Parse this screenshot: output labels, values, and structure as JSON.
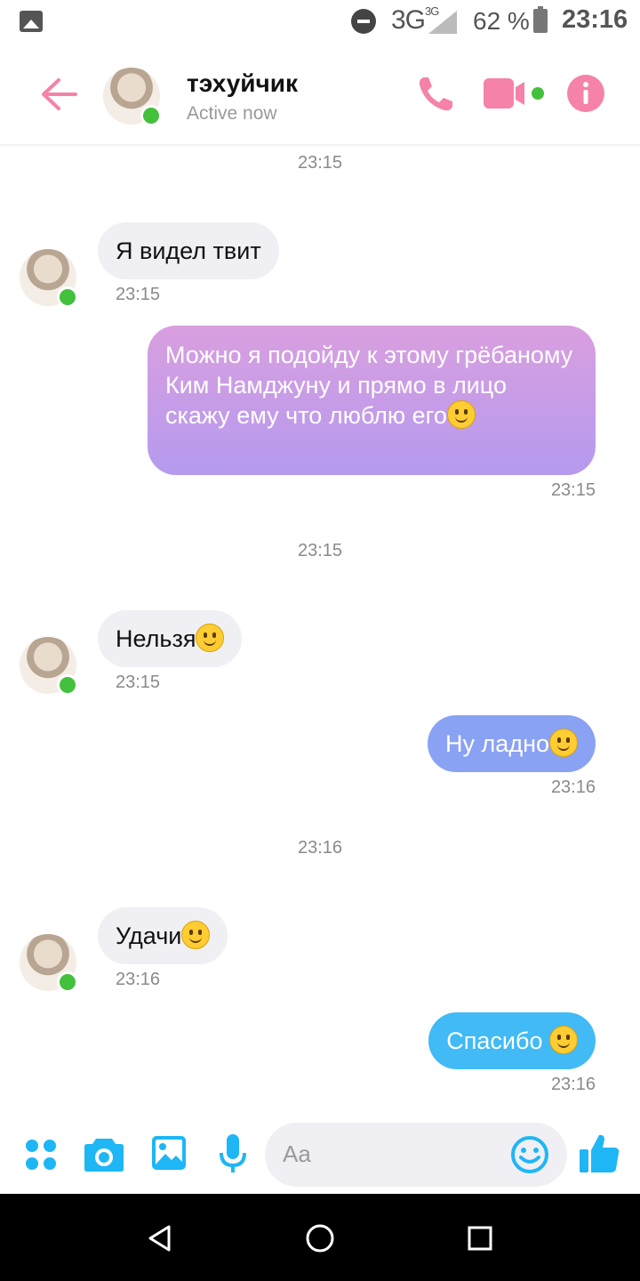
{
  "status_bar": {
    "network": "3G",
    "network_sup": "3G",
    "battery": "62 %",
    "time": "23:16"
  },
  "header": {
    "name": "тэхуйчик",
    "status": "Active now"
  },
  "messages": [
    {
      "type": "timestamp",
      "text": "23:15"
    },
    {
      "type": "incoming",
      "text": "Я видел твит",
      "time": "23:15",
      "emoji": false
    },
    {
      "type": "outgoing",
      "text": "Можно я подойду к этому грёбаному Ким Намджуну и прямо в лицо скажу ему что люблю его",
      "time": "23:15",
      "emoji": true,
      "color": "#c49be8"
    },
    {
      "type": "timestamp",
      "text": "23:15"
    },
    {
      "type": "incoming",
      "text": "Нельзя",
      "time": "23:15",
      "emoji": true
    },
    {
      "type": "outgoing",
      "text": "Ну ладно",
      "time": "23:16",
      "emoji": true,
      "color": "#8aa2f3"
    },
    {
      "type": "timestamp",
      "text": "23:16"
    },
    {
      "type": "incoming",
      "text": "Удачи",
      "time": "23:16",
      "emoji": true
    },
    {
      "type": "outgoing",
      "text": "Спасибо ",
      "time": "23:16",
      "emoji": true,
      "color": "#41baf6"
    }
  ],
  "composer": {
    "placeholder": "Aa"
  },
  "colors": {
    "accent_pink": "#f582a8",
    "accent_blue": "#1fb6f5",
    "online_green": "#43c03c"
  }
}
